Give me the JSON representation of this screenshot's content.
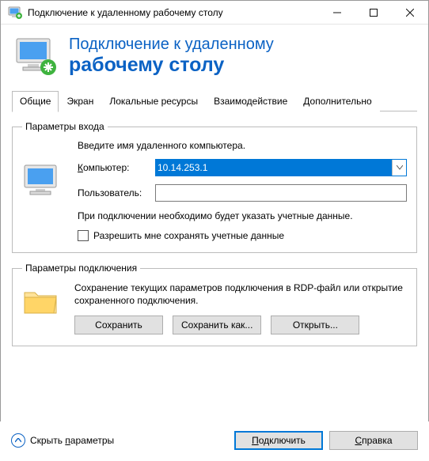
{
  "window": {
    "title": "Подключение к удаленному рабочему столу"
  },
  "banner": {
    "line1": "Подключение к удаленному",
    "line2": "рабочему столу"
  },
  "tabs": {
    "general": "Общие",
    "display": "Экран",
    "local": "Локальные ресурсы",
    "experience": "Взаимодействие",
    "advanced": "Дополнительно"
  },
  "login": {
    "legend": "Параметры входа",
    "instruction": "Введите имя удаленного компьютера.",
    "computer_label": "Компьютер:",
    "computer_value": "10.14.253.1",
    "user_label": "Пользователь:",
    "user_value": "",
    "cred_note": "При подключении необходимо будет указать учетные данные.",
    "save_creds_label": "Разрешить мне сохранять учетные данные"
  },
  "connection": {
    "legend": "Параметры подключения",
    "text": "Сохранение текущих параметров подключения в RDP-файл или открытие сохраненного подключения.",
    "save": "Сохранить",
    "save_as": "Сохранить как...",
    "open": "Открыть..."
  },
  "footer": {
    "collapse": "Скрыть параметры",
    "connect": "Подключить",
    "help": "Справка"
  }
}
